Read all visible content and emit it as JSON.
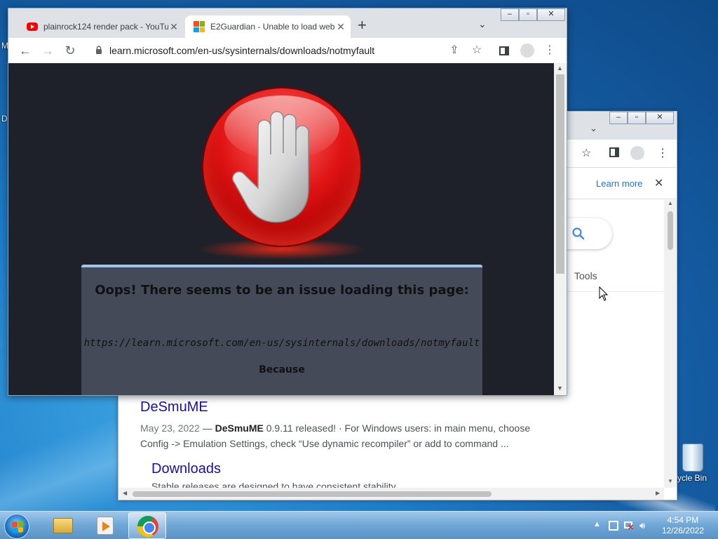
{
  "desktop": {
    "left_fragments": [
      "M",
      "D"
    ],
    "recycle_bin_label": "cycle Bin"
  },
  "background_window": {
    "info_link": "Learn more",
    "tools_tab": "Tools",
    "results": [
      {
        "title": "DeSmuME",
        "date": "May 23, 2022",
        "snippet_bold": "DeSmuME",
        "snippet_line1_rest": " 0.9.11 released! · For Windows users: in main menu, choose",
        "snippet_line2": "Config -> Emulation Settings, check “Use dynamic recompiler” or add to command ...",
        "sublink_title": "Downloads",
        "sublink_snippet": "Stable releases are designed to have consistent stability"
      }
    ]
  },
  "foreground_window": {
    "tabs": [
      {
        "title": "plainrock124 render pack - YouTu",
        "favicon": "youtube-icon",
        "active": false
      },
      {
        "title": "E2Guardian - Unable to load web",
        "favicon": "microsoft-icon",
        "active": true
      }
    ],
    "url": "learn.microsoft.com/en-us/sysinternals/downloads/notmyfault",
    "block_page": {
      "heading": "Oops! There seems to be an issue loading this page:",
      "blocked_url": "https://learn.microsoft.com/en-us/sysinternals/downloads/notmyfault",
      "because": "Because"
    }
  },
  "taskbar": {
    "clock_time": "4:54 PM",
    "clock_date": "12/26/2022"
  },
  "colors": {
    "link": "#1a0dab",
    "stop_red": "#e01414",
    "block_bg": "#1e2129",
    "message_box": "#454a58"
  }
}
